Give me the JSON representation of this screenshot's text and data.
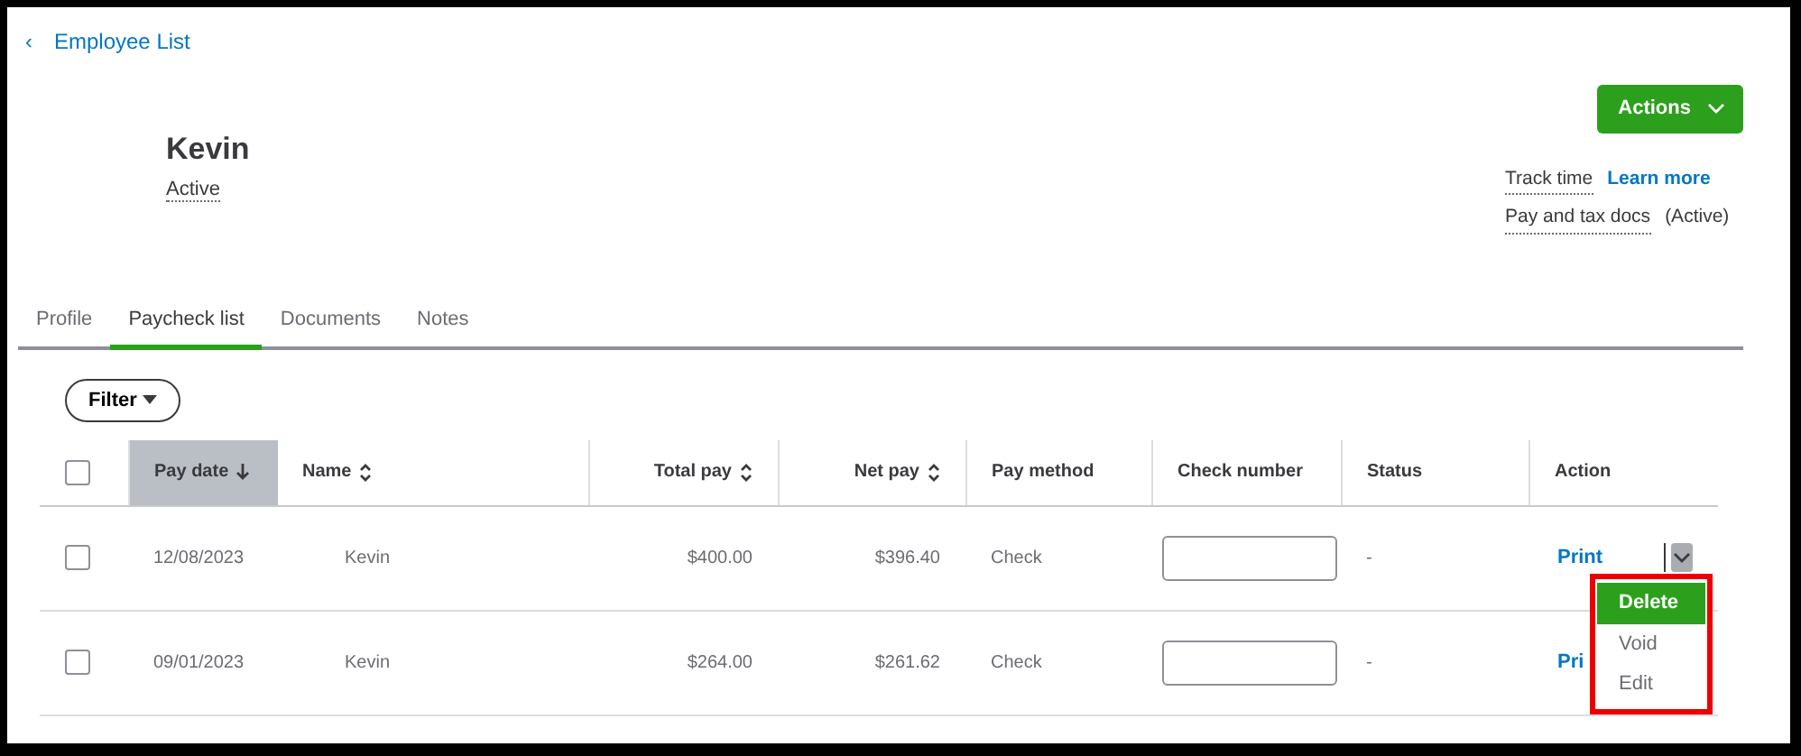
{
  "back_link": {
    "icon": "‹",
    "label": "Employee List"
  },
  "employee": {
    "name": "Kevin",
    "status": "Active"
  },
  "actions_button": {
    "label": "Actions"
  },
  "links": [
    {
      "label": "Track time",
      "kind": "dotted"
    },
    {
      "label": "Learn more",
      "kind": "link"
    },
    {
      "label": "Pay and tax docs",
      "kind": "dotted"
    },
    {
      "label": "(Active)",
      "kind": "plain"
    }
  ],
  "tabs": [
    {
      "label": "Profile",
      "selected": false
    },
    {
      "label": "Paycheck list",
      "selected": true
    },
    {
      "label": "Documents",
      "selected": false
    },
    {
      "label": "Notes",
      "selected": false
    }
  ],
  "filter_button": {
    "label": "Filter"
  },
  "table": {
    "select_all": {
      "checked": false
    },
    "columns": [
      {
        "label": "Pay date",
        "sorted": true,
        "kind": "text"
      },
      {
        "label": "Name",
        "sorted": false,
        "kind": "text"
      },
      {
        "label": "Total pay",
        "sorted": false,
        "kind": "money"
      },
      {
        "label": "Net pay",
        "sorted": false,
        "kind": "money"
      },
      {
        "label": "Pay method",
        "kind": "text"
      },
      {
        "label": "Check number",
        "kind": "text"
      },
      {
        "label": "Status",
        "kind": "text"
      },
      {
        "label": "Action",
        "kind": "text"
      }
    ],
    "rows": [
      {
        "checked": false,
        "cells": [
          "12/08/2023",
          "Kevin",
          "$400.00",
          "$396.40",
          "Check"
        ],
        "status": "-",
        "action": "Print",
        "menu_toggle": true
      },
      {
        "checked": false,
        "cells": [
          "09/01/2023",
          "Kevin",
          "$264.00",
          "$261.62",
          "Check"
        ],
        "status": "-",
        "action": "Pri",
        "menu_toggle": false
      }
    ]
  },
  "action_menu": [
    {
      "label": "Delete",
      "selected": true
    },
    {
      "label": "Void",
      "selected": false
    },
    {
      "label": "Edit",
      "selected": false
    }
  ]
}
